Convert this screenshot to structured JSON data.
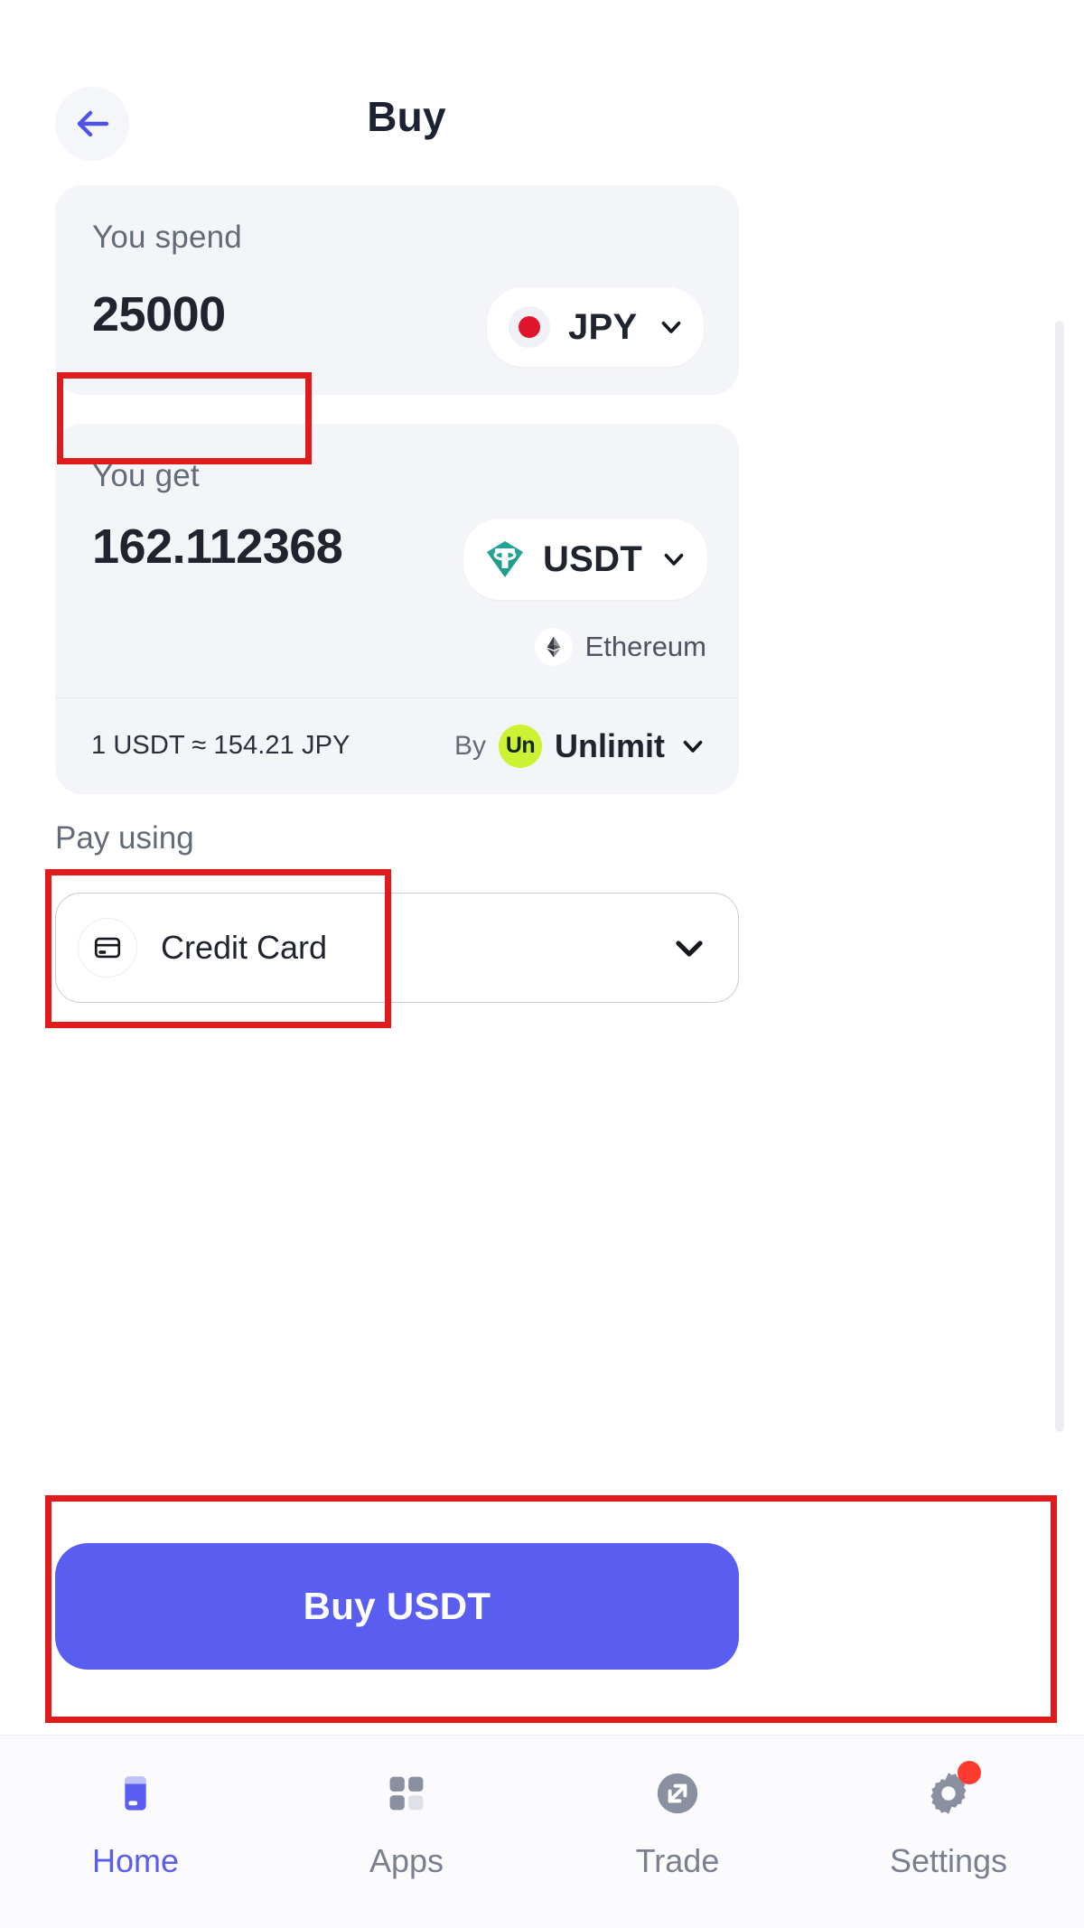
{
  "header": {
    "title": "Buy",
    "back_icon": "arrow-left-icon"
  },
  "spend": {
    "label": "You spend",
    "amount": "25000",
    "currency": "JPY",
    "currency_icon": "japan-flag-icon",
    "chevron_icon": "chevron-down-icon"
  },
  "get": {
    "label": "You get",
    "amount": "162.112368",
    "currency": "USDT",
    "currency_icon": "tether-icon",
    "network": "Ethereum",
    "network_icon": "ethereum-icon",
    "chevron_icon": "chevron-down-icon"
  },
  "rate": {
    "text": "1 USDT ≈ 154.21 JPY",
    "by_label": "By",
    "provider_badge": "Un",
    "provider_name": "Unlimit",
    "chevron_icon": "chevron-down-icon"
  },
  "payment": {
    "label": "Pay using",
    "method": "Credit Card",
    "method_icon": "credit-card-icon",
    "chevron_icon": "chevron-down-icon"
  },
  "cta": {
    "label": "Buy USDT"
  },
  "nav": {
    "items": [
      {
        "label": "Home",
        "icon": "home-icon",
        "active": true,
        "badge": false
      },
      {
        "label": "Apps",
        "icon": "grid-icon",
        "active": false,
        "badge": false
      },
      {
        "label": "Trade",
        "icon": "expand-arrows-icon",
        "active": false,
        "badge": false
      },
      {
        "label": "Settings",
        "icon": "gear-icon",
        "active": false,
        "badge": true
      }
    ]
  },
  "colors": {
    "accent": "#5a5ef0",
    "card_bg": "#f4f5f8",
    "tether": "#26a17b",
    "unlimit": "#ccf233",
    "annotation": "#e01b1b",
    "badge": "#ff3b30"
  }
}
